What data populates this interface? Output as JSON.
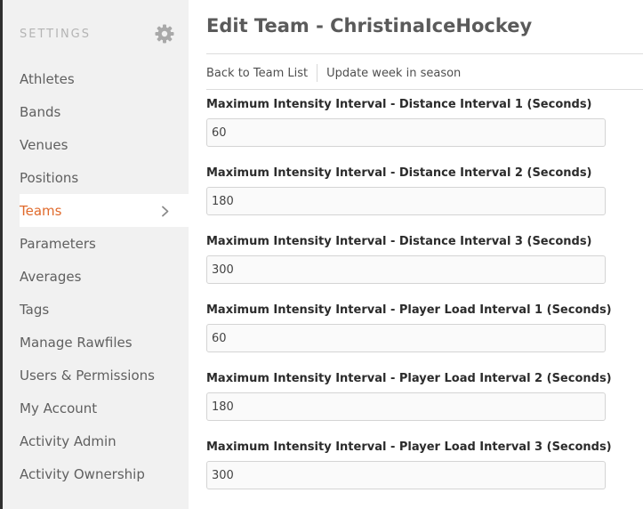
{
  "sidebar": {
    "title": "SETTINGS",
    "settings_icon": "gear-icon",
    "items": [
      {
        "label": "Athletes"
      },
      {
        "label": "Bands"
      },
      {
        "label": "Venues"
      },
      {
        "label": "Positions"
      },
      {
        "label": "Teams",
        "active": true
      },
      {
        "label": "Parameters"
      },
      {
        "label": "Averages"
      },
      {
        "label": "Tags"
      },
      {
        "label": "Manage Rawfiles"
      },
      {
        "label": "Users & Permissions"
      },
      {
        "label": "My Account"
      },
      {
        "label": "Activity Admin"
      },
      {
        "label": "Activity Ownership"
      }
    ],
    "active_icon": "chevron-right-icon"
  },
  "main": {
    "title": "Edit Team - ChristinaIceHockey",
    "links": {
      "back": "Back to Team List",
      "update_week": "Update week in season"
    },
    "fields": [
      {
        "label": "Maximum Intensity Interval - Distance Interval 1 (Seconds)",
        "value": "60"
      },
      {
        "label": "Maximum Intensity Interval - Distance Interval 2 (Seconds)",
        "value": "180"
      },
      {
        "label": "Maximum Intensity Interval - Distance Interval 3 (Seconds)",
        "value": "300"
      },
      {
        "label": "Maximum Intensity Interval - Player Load Interval 1 (Seconds)",
        "value": "60"
      },
      {
        "label": "Maximum Intensity Interval - Player Load Interval 2 (Seconds)",
        "value": "180"
      },
      {
        "label": "Maximum Intensity Interval - Player Load Interval 3 (Seconds)",
        "value": "300"
      }
    ]
  },
  "colors": {
    "accent": "#e06a2c",
    "sidebar_bg": "#f1f1f1",
    "nav_text": "#606060"
  }
}
